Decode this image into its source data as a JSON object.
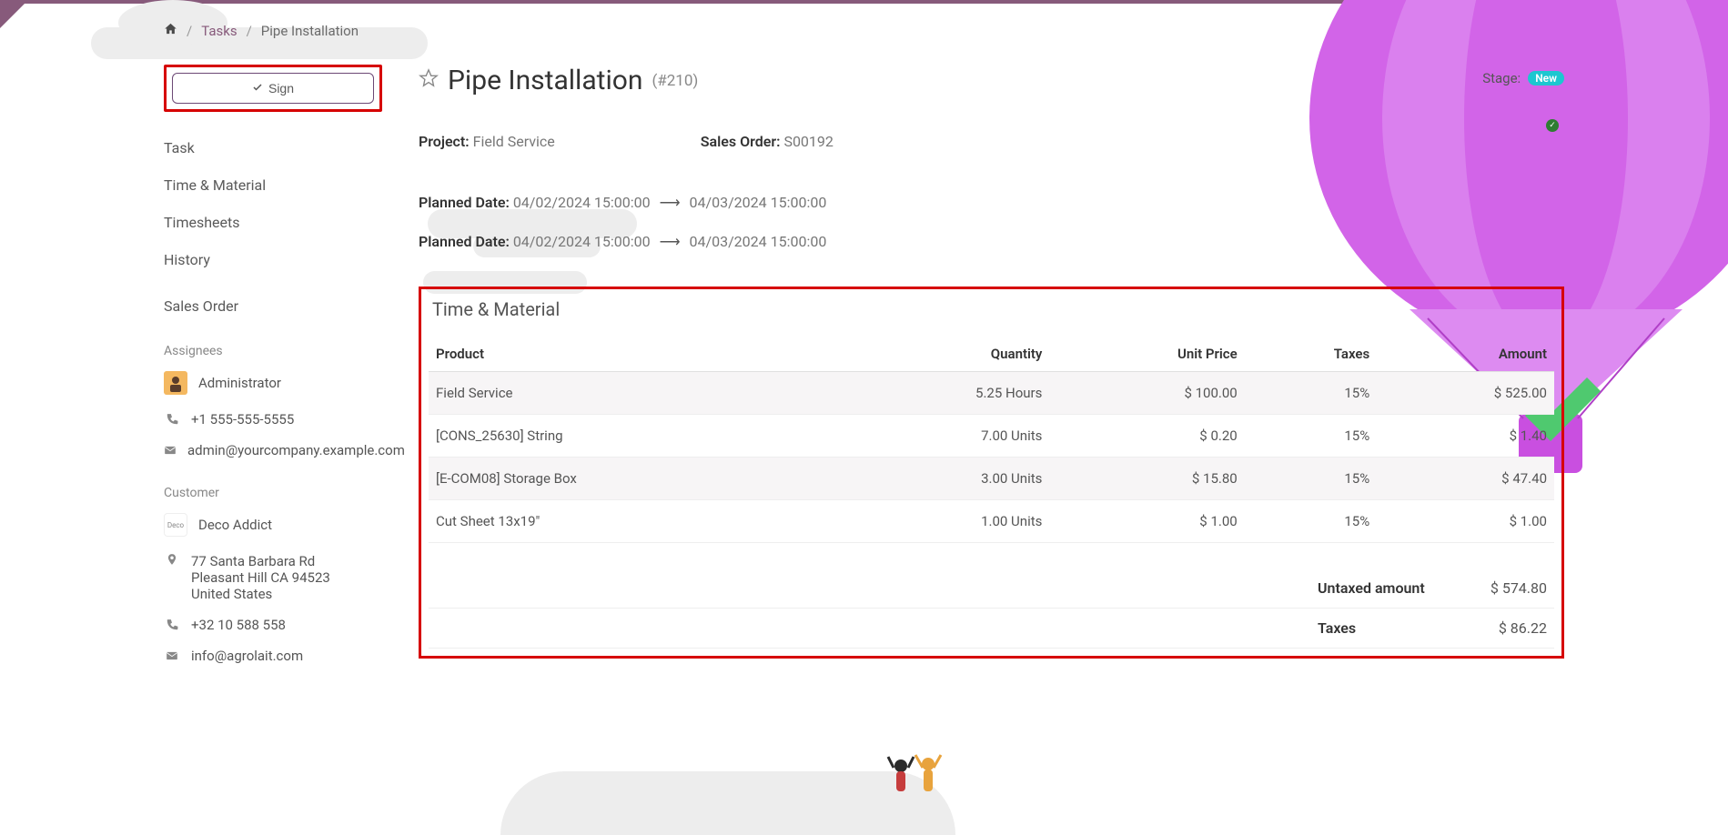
{
  "breadcrumb": {
    "tasks": "Tasks",
    "current": "Pipe Installation"
  },
  "sign_button": "Sign",
  "sidebar": {
    "nav": [
      "Task",
      "Time & Material",
      "Timesheets",
      "History"
    ],
    "sales_order": "Sales Order",
    "assignees_h": "Assignees",
    "assignee_name": "Administrator",
    "phone": "+1 555-555-5555",
    "email": "admin@yourcompany.example.com",
    "customer_h": "Customer",
    "customer_name": "Deco Addict",
    "addr1": "77 Santa Barbara Rd",
    "addr2": "Pleasant Hill CA 94523",
    "addr3": "United States",
    "cust_phone": "+32 10 588 558",
    "cust_email": "info@agrolait.com"
  },
  "header": {
    "title": "Pipe Installation",
    "ref": "(#210)",
    "stage_label": "Stage:",
    "stage_value": "New"
  },
  "details": {
    "project_label": "Project:",
    "project_value": "Field Service",
    "sales_order_label": "Sales Order:",
    "sales_order_value": "S00192",
    "planned_date_label": "Planned Date:",
    "planned_from": "04/02/2024 15:00:00",
    "planned_to": "04/03/2024 15:00:00"
  },
  "tm": {
    "title": "Time & Material",
    "cols": {
      "product": "Product",
      "qty": "Quantity",
      "price": "Unit Price",
      "taxes": "Taxes",
      "amount": "Amount"
    },
    "rows": [
      {
        "product": "Field Service",
        "qty": "5.25 Hours",
        "price": "$ 100.00",
        "taxes": "15%",
        "amount": "$ 525.00"
      },
      {
        "product": "[CONS_25630] String",
        "qty": "7.00 Units",
        "price": "$ 0.20",
        "taxes": "15%",
        "amount": "$ 1.40"
      },
      {
        "product": "[E-COM08] Storage Box",
        "qty": "3.00 Units",
        "price": "$ 15.80",
        "taxes": "15%",
        "amount": "$ 47.40"
      },
      {
        "product": "Cut Sheet 13x19\"",
        "qty": "1.00 Units",
        "price": "$ 1.00",
        "taxes": "15%",
        "amount": "$ 1.00"
      }
    ],
    "totals": {
      "untaxed_label": "Untaxed amount",
      "untaxed_value": "$ 574.80",
      "taxes_label": "Taxes",
      "taxes_value": "$ 86.22"
    }
  }
}
